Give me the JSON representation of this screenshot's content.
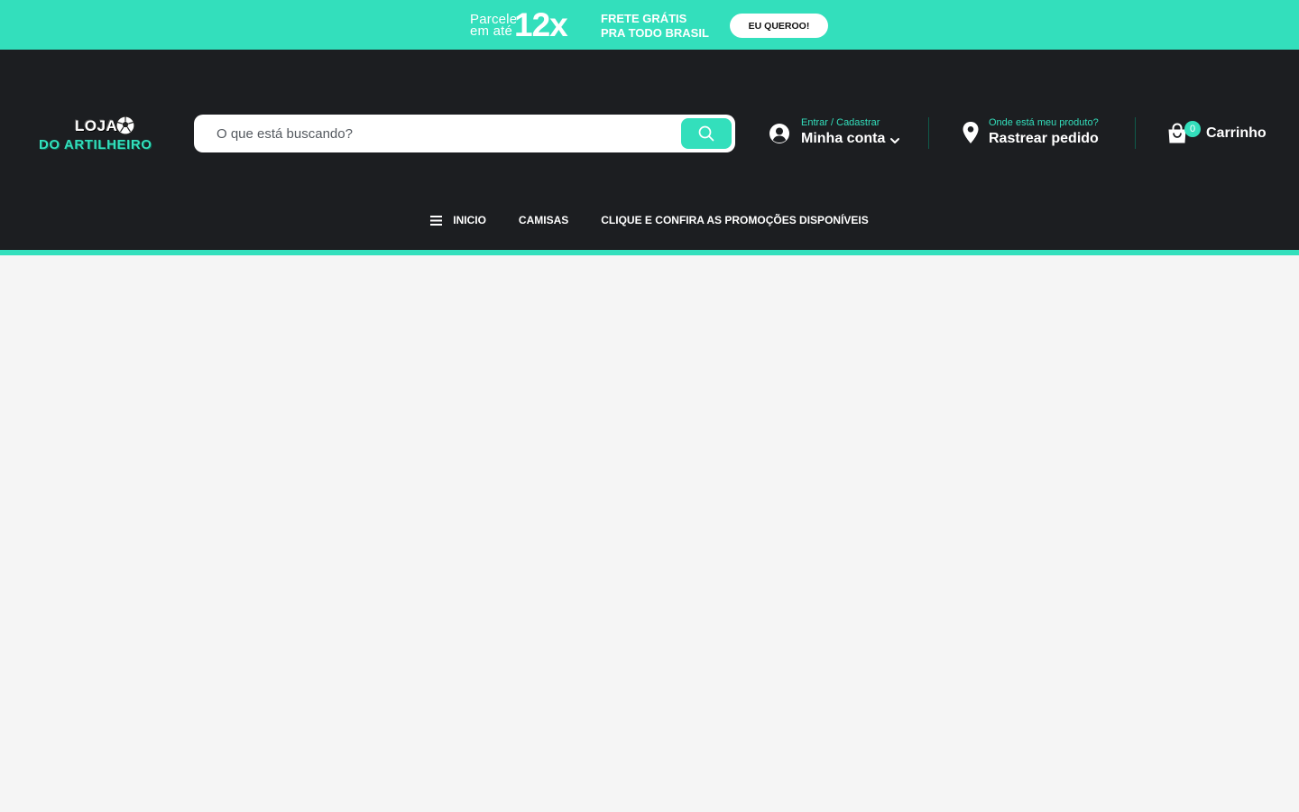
{
  "promo": {
    "installments_line1": "Parcele",
    "installments_line2": "em até",
    "installments_value": "12x",
    "shipping_line1": "FRETE GRÁTIS",
    "shipping_line2": "PRA TODO BRASIL",
    "cta_label": "EU QUEROO!"
  },
  "logo": {
    "line1": "LOJA",
    "line2": "DO ARTILHEIRO"
  },
  "search": {
    "placeholder": "O que está buscando?",
    "value": ""
  },
  "account": {
    "small_label": "Entrar / Cadastrar",
    "label": "Minha conta"
  },
  "tracking": {
    "small_label": "Onde está meu produto?",
    "label": "Rastrear pedido"
  },
  "cart": {
    "count": "0",
    "label": "Carrinho"
  },
  "nav": {
    "items": [
      {
        "label": "INICIO"
      },
      {
        "label": "CAMISAS"
      },
      {
        "label": "CLIQUE E CONFIRA AS PROMOÇÕES DISPONÍVEIS"
      }
    ]
  },
  "colors": {
    "accent": "#33dfbc",
    "header_bg": "#1c1e21",
    "page_bg": "#f5f5f5"
  },
  "icons": [
    "search-icon",
    "user-circle-icon",
    "chevron-down-icon",
    "map-pin-icon",
    "shopping-bag-icon",
    "menu-icon",
    "soccer-ball-icon"
  ]
}
